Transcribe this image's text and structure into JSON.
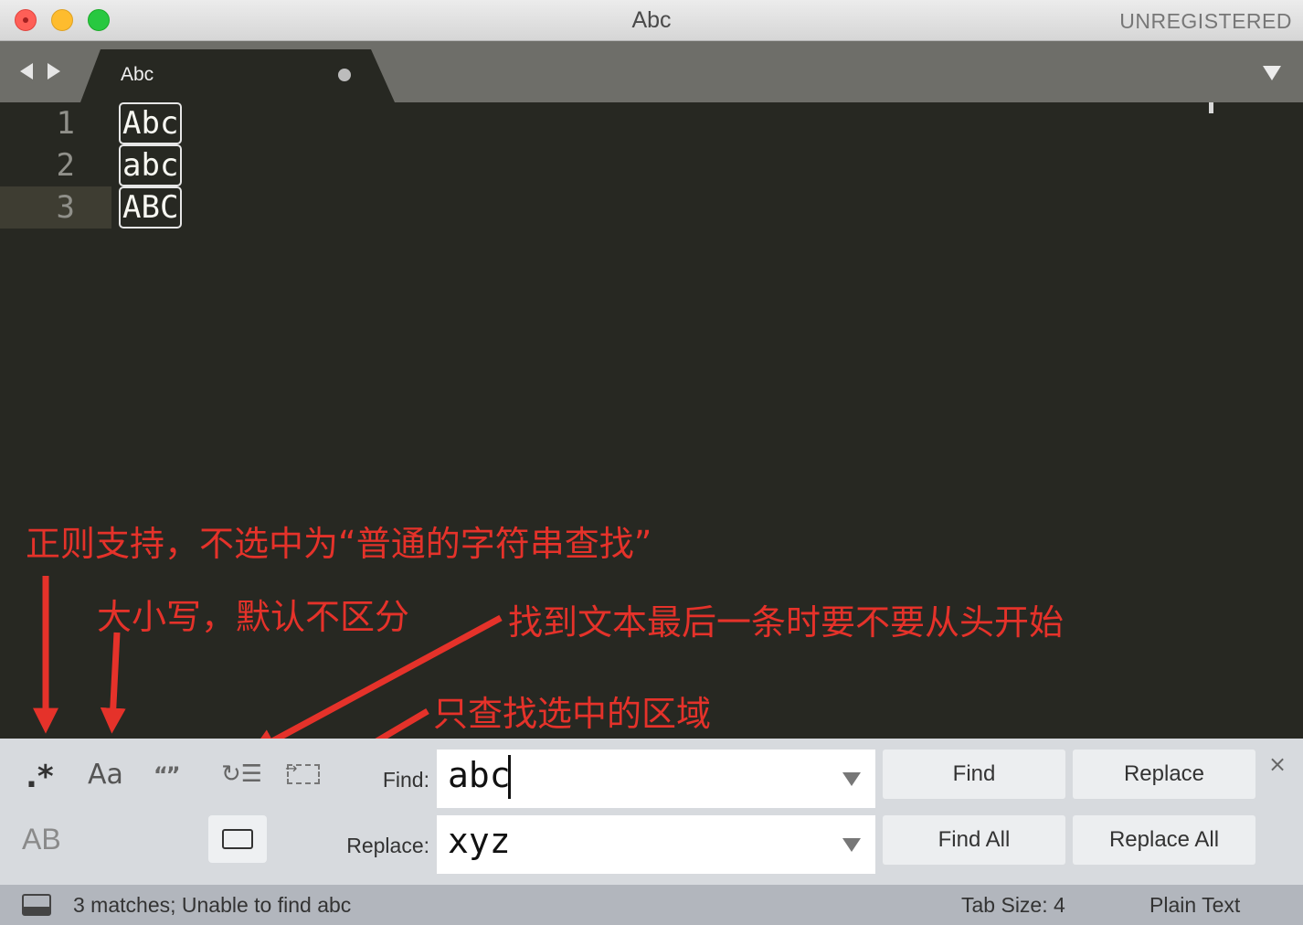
{
  "window": {
    "title": "Abc",
    "status_tag": "UNREGISTERED"
  },
  "tab": {
    "label": "Abc",
    "modified": true
  },
  "editor": {
    "lines": [
      {
        "number": "1",
        "text": "Abc"
      },
      {
        "number": "2",
        "text": "abc"
      },
      {
        "number": "3",
        "text": "ABC"
      }
    ],
    "current_line": 3
  },
  "annotations": {
    "regex": "正则支持，不选中为“普通的字符串查找”",
    "case": "大小写，默认不区分",
    "wrap": "找到文本最后一条时要不要从头开始",
    "selection": "只查找选中的区域"
  },
  "find_panel": {
    "options": {
      "regex": ".*",
      "case_sensitive": "Aa",
      "whole_word": "“”",
      "wrap": "↻☰",
      "preserve_case": "AB"
    },
    "find_label": "Find:",
    "find_value": "abc",
    "replace_label": "Replace:",
    "replace_value": "xyz",
    "buttons": {
      "find": "Find",
      "replace": "Replace",
      "find_all": "Find All",
      "replace_all": "Replace All"
    },
    "close": "×"
  },
  "status_bar": {
    "message": "3 matches; Unable to find abc",
    "tab_size": "Tab Size: 4",
    "syntax": "Plain Text"
  },
  "colors": {
    "editor_bg": "#272822",
    "annotation": "#e5322a",
    "tab_bar": "#6e6e69",
    "panel_bg": "#d7dade"
  }
}
